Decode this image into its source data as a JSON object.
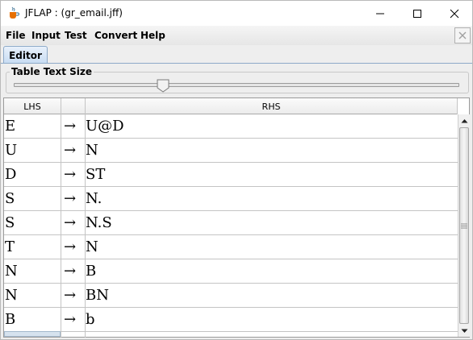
{
  "window": {
    "title": "JFLAP : (gr_email.jff)",
    "app_icon": "java-cup-icon",
    "controls": [
      "minimize-icon",
      "maximize-icon",
      "close-icon"
    ]
  },
  "menubar": {
    "items": [
      "File",
      "Input",
      "Test",
      "Convert",
      "Help"
    ],
    "close_icon": "close-icon"
  },
  "tabs": [
    {
      "label": "Editor",
      "selected": true
    }
  ],
  "slider": {
    "label": "Table Text Size",
    "value_fraction": 0.33
  },
  "table": {
    "columns": [
      "LHS",
      "",
      "RHS"
    ],
    "rows": [
      {
        "lhs": "E",
        "arrow": "→",
        "rhs": "U@D"
      },
      {
        "lhs": "U",
        "arrow": "→",
        "rhs": "N"
      },
      {
        "lhs": "D",
        "arrow": "→",
        "rhs": "ST"
      },
      {
        "lhs": "S",
        "arrow": "→",
        "rhs": "N."
      },
      {
        "lhs": "S",
        "arrow": "→",
        "rhs": "N.S"
      },
      {
        "lhs": "T",
        "arrow": "→",
        "rhs": "N"
      },
      {
        "lhs": "N",
        "arrow": "→",
        "rhs": "B"
      },
      {
        "lhs": "N",
        "arrow": "→",
        "rhs": "BN"
      },
      {
        "lhs": "B",
        "arrow": "→",
        "rhs": "b"
      }
    ]
  },
  "colors": {
    "tab_blue": "#c7dcf2",
    "border": "#9a9a9a",
    "window_bg": "#eeeeee"
  }
}
